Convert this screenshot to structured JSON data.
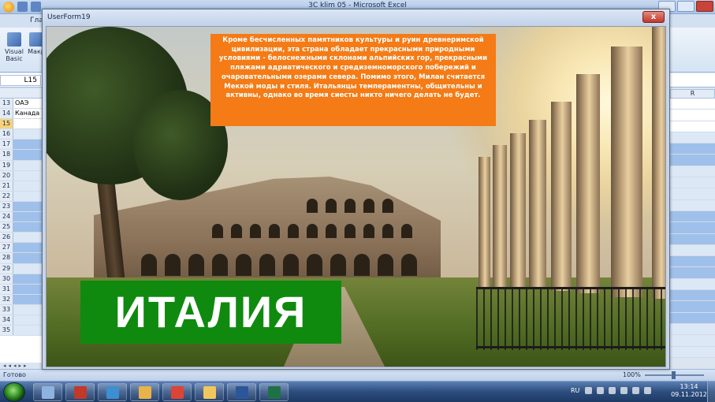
{
  "excel": {
    "title": "3C klim 05 - Microsoft Excel",
    "tab_home": "Глав",
    "ribbon_buttons": [
      {
        "label": "Visual Basic",
        "icon": "visual-basic-icon"
      },
      {
        "label": "Макр",
        "icon": "macros-icon"
      }
    ],
    "name_box": "L15",
    "column_header_right": "R",
    "rows": [
      {
        "num": "13",
        "cell": "ОАЭ"
      },
      {
        "num": "14",
        "cell": "Канада"
      },
      {
        "num": "15",
        "cell": ""
      },
      {
        "num": "16",
        "cell": ""
      },
      {
        "num": "17",
        "cell": ""
      },
      {
        "num": "18",
        "cell": ""
      },
      {
        "num": "19",
        "cell": ""
      },
      {
        "num": "20",
        "cell": ""
      },
      {
        "num": "21",
        "cell": ""
      },
      {
        "num": "22",
        "cell": ""
      },
      {
        "num": "23",
        "cell": ""
      },
      {
        "num": "24",
        "cell": ""
      },
      {
        "num": "25",
        "cell": ""
      },
      {
        "num": "26",
        "cell": ""
      },
      {
        "num": "27",
        "cell": ""
      },
      {
        "num": "28",
        "cell": ""
      },
      {
        "num": "29",
        "cell": ""
      },
      {
        "num": "30",
        "cell": ""
      },
      {
        "num": "31",
        "cell": ""
      },
      {
        "num": "32",
        "cell": ""
      },
      {
        "num": "33",
        "cell": ""
      },
      {
        "num": "34",
        "cell": ""
      },
      {
        "num": "35",
        "cell": ""
      }
    ],
    "status_ready": "Готово",
    "zoom": "100%",
    "colors": {
      "row_blue": "#9fc0ea",
      "row_light": "#dde8f6",
      "selected_row": "#f6d37c"
    }
  },
  "userform": {
    "title": "UserForm19",
    "close_label": "x",
    "info_text": "Кроме бесчисленных памятников культуры и руин древнеримской цивилизации, эта страна обладает прекрасными природными условиями - белоснежными склонами альпийских гор, прекрасными пляжами адриатического и средиземноморского побережий и очаровательными озерами севера. Помимо этого, Милан считается Меккой моды и стиля. Итальянцы темпераментны, общительны и активны, однако во время сиесты никто ничего делать не будет.",
    "country_title": "ИТАЛИЯ",
    "colors": {
      "info_bg": "#f47b16",
      "title_bg": "#0f8a0f"
    }
  },
  "taskbar": {
    "buttons": [
      {
        "name": "excel-file-icon",
        "color": "#8fb3e0"
      },
      {
        "name": "archive-app-icon",
        "color": "#c0392b"
      },
      {
        "name": "window-app-icon",
        "color": "#3d8fd1"
      },
      {
        "name": "paint-app-icon",
        "color": "#e8b34b"
      },
      {
        "name": "chrome-icon",
        "color": "#db4437"
      },
      {
        "name": "folder-icon",
        "color": "#f0c75e"
      },
      {
        "name": "word-icon",
        "color": "#2b579a"
      },
      {
        "name": "excel-icon",
        "color": "#1e7145"
      }
    ],
    "lang": "RU",
    "time": "13:14",
    "date": "09.11.2012"
  }
}
